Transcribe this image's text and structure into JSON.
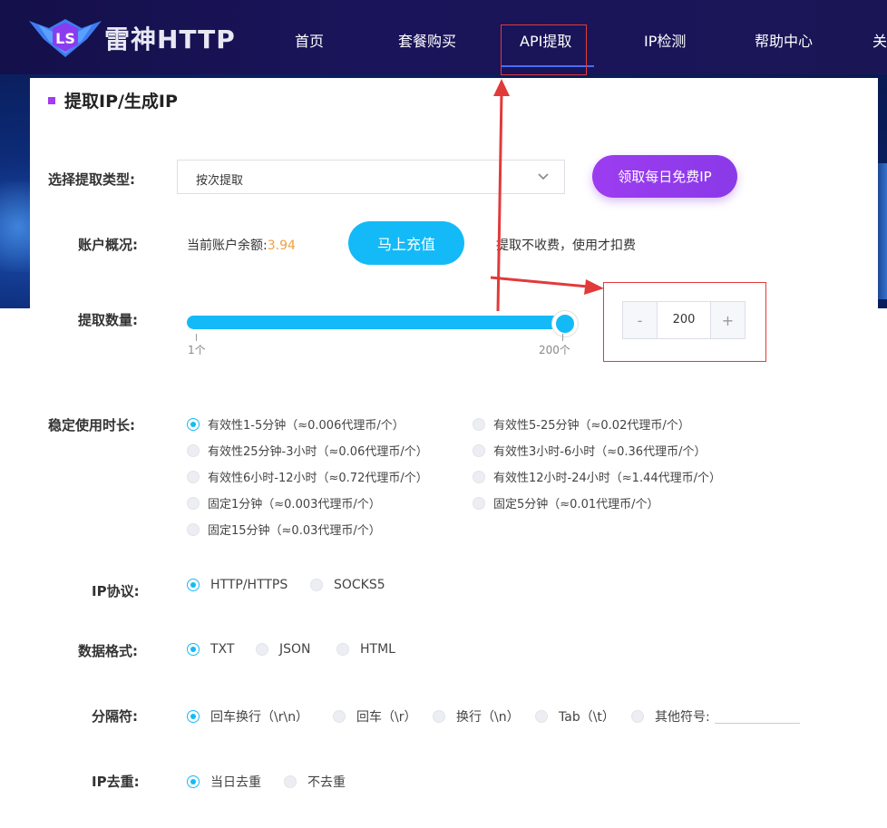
{
  "header": {
    "brand": "雷神HTTP",
    "nav": [
      "首页",
      "套餐购买",
      "API提取",
      "IP检测",
      "帮助中心",
      "关"
    ],
    "active_index": 2
  },
  "page": {
    "section_title": "提取IP/生成IP"
  },
  "form": {
    "type_label": "选择提取类型:",
    "type_value": "按次提取",
    "free_button": "领取每日免费IP",
    "account_label": "账户概况:",
    "balance_prefix": "当前账户余额:",
    "balance_value": "3.94",
    "recharge_button": "马上充值",
    "fee_note": "提取不收费，使用才扣费",
    "quantity_label": "提取数量:",
    "slider_min_label": "1个",
    "slider_max_label": "200个",
    "quantity_value": "200",
    "minus": "-",
    "plus": "+",
    "duration_label": "稳定使用时长:",
    "durations": [
      "有效性1-5分钟（≈0.006代理币/个）",
      "有效性5-25分钟（≈0.02代理币/个）",
      "有效性25分钟-3小时（≈0.06代理币/个）",
      "有效性3小时-6小时（≈0.36代理币/个）",
      "有效性6小时-12小时（≈0.72代理币/个）",
      "有效性12小时-24小时（≈1.44代理币/个）",
      "固定1分钟（≈0.003代理币/个）",
      "固定5分钟（≈0.01代理币/个）",
      "固定15分钟（≈0.03代理币/个）"
    ],
    "protocol_label": "IP协议:",
    "protocols": [
      "HTTP/HTTPS",
      "SOCKS5"
    ],
    "format_label": "数据格式:",
    "formats": [
      "TXT",
      "JSON",
      "HTML"
    ],
    "separator_label": "分隔符:",
    "separators": [
      "回车换行（\\r\\n）",
      "回车（\\r）",
      "换行（\\n）",
      "Tab（\\t）",
      "其他符号:"
    ],
    "dedupe_label": "IP去重:",
    "dedupe": [
      "当日去重",
      "不去重"
    ]
  },
  "colors": {
    "accent_blue": "#14baf7",
    "accent_purple": "#9c3cf0",
    "annotation_red": "#e23a3a",
    "balance_orange": "#f0a040"
  }
}
